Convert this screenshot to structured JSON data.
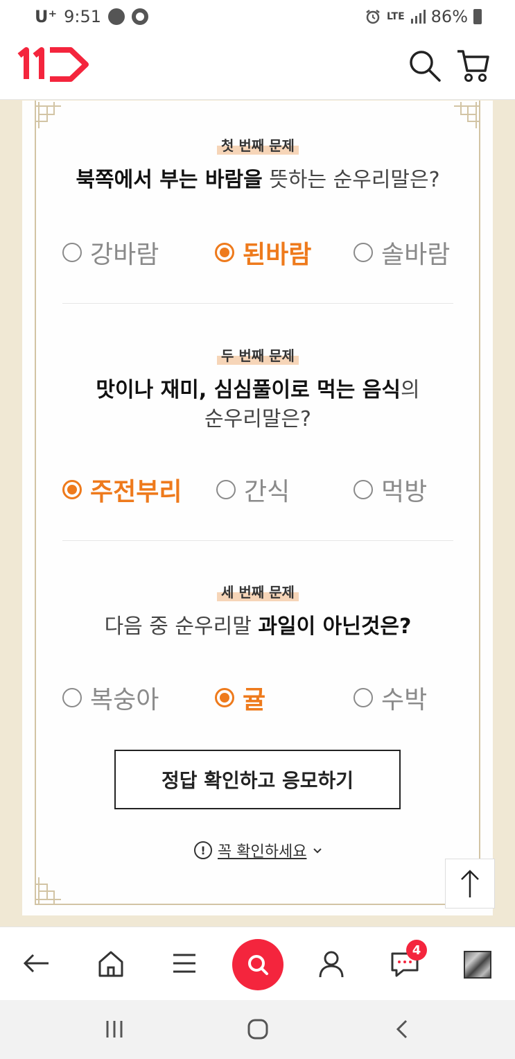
{
  "status_bar": {
    "carrier": "U⁺",
    "time": "9:51",
    "network": "LTE",
    "battery": "86%"
  },
  "header": {
    "logo": "11st-logo",
    "search_icon": "search-icon",
    "cart_icon": "cart-icon"
  },
  "quiz": {
    "questions": [
      {
        "tag": "첫 번째 문제",
        "text_bold": "북쪽에서 부는 바람을",
        "text_rest": " 뜻하는 순우리말은?",
        "options": [
          {
            "label": "강바람",
            "selected": false
          },
          {
            "label": "된바람",
            "selected": true
          },
          {
            "label": "솔바람",
            "selected": false
          }
        ]
      },
      {
        "tag": "두 번째 문제",
        "text_bold": "맛이나 재미, 심심풀이로 먹는 음식",
        "text_rest": "의",
        "text_line2": "순우리말은?",
        "options": [
          {
            "label": "주전부리",
            "selected": true
          },
          {
            "label": "간식",
            "selected": false
          },
          {
            "label": "먹방",
            "selected": false
          }
        ]
      },
      {
        "tag": "세 번째 문제",
        "text_rest": "다음 중 순우리말 ",
        "text_bold": "과일이 아닌것은?",
        "options": [
          {
            "label": "복숭아",
            "selected": false
          },
          {
            "label": "귤",
            "selected": true
          },
          {
            "label": "수박",
            "selected": false
          }
        ]
      }
    ],
    "submit_label": "정답 확인하고 응모하기",
    "notice_icon": "!",
    "notice_label": "꼭 확인하세요"
  },
  "bottom_nav": {
    "message_badge": "4"
  },
  "colors": {
    "accent": "#ee7a1c",
    "brand_red": "#f4253d",
    "frame": "#d2c4a4",
    "page_bg": "#f0e8d4"
  }
}
